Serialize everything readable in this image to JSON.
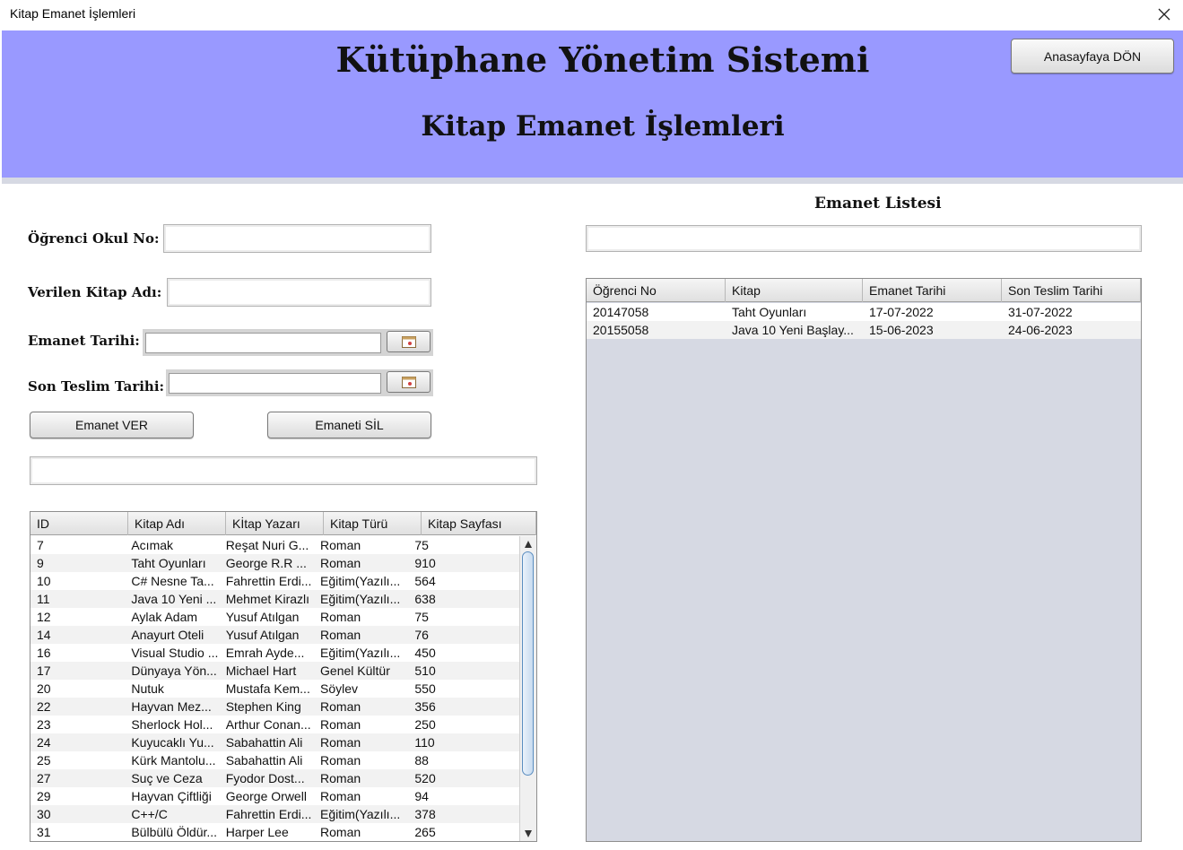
{
  "window": {
    "title": "Kitap Emanet İşlemleri",
    "close_icon": "close-icon"
  },
  "header": {
    "title": "Kütüphane Yönetim Sistemi",
    "subtitle": "Kitap Emanet İşlemleri",
    "home_button": "Anasayfaya DÖN",
    "background": "#9999ff"
  },
  "form": {
    "student_no_label": "Öğrenci Okul No:",
    "student_no_value": "",
    "book_name_label": "Verilen Kitap Adı:",
    "book_name_value": "",
    "loan_date_label": "Emanet Tarihi:",
    "loan_date_value": "",
    "due_date_label": "Son Teslim Tarihi:",
    "due_date_value": "",
    "give_button": "Emanet VER",
    "delete_button": "Emaneti SİL",
    "search_value": ""
  },
  "books_table": {
    "columns": [
      "ID",
      "Kitap Adı",
      "Kİtap Yazarı",
      "Kitap Türü",
      "Kitap Sayfası"
    ],
    "rows": [
      [
        "7",
        "Acımak",
        "Reşat Nuri G...",
        "Roman",
        "75"
      ],
      [
        "9",
        "Taht Oyunları",
        "George R.R ...",
        "Roman",
        "910"
      ],
      [
        "10",
        "C# Nesne Ta...",
        "Fahrettin Erdi...",
        "Eğitim(Yazılı...",
        "564"
      ],
      [
        "11",
        "Java 10 Yeni ...",
        "Mehmet Kirazlı",
        "Eğitim(Yazılı...",
        "638"
      ],
      [
        "12",
        "Aylak Adam",
        "Yusuf Atılgan",
        "Roman",
        "75"
      ],
      [
        "14",
        "Anayurt Oteli",
        "Yusuf Atılgan",
        "Roman",
        "76"
      ],
      [
        "16",
        "Visual Studio ...",
        "Emrah Ayde...",
        "Eğitim(Yazılı...",
        "450"
      ],
      [
        "17",
        "Dünyaya Yön...",
        "Michael Hart",
        "Genel Kültür",
        "510"
      ],
      [
        "20",
        "Nutuk",
        "Mustafa Kem...",
        "Söylev",
        "550"
      ],
      [
        "22",
        "Hayvan Mez...",
        "Stephen King",
        "Roman",
        "356"
      ],
      [
        "23",
        "Sherlock Hol...",
        "Arthur Conan...",
        "Roman",
        "250"
      ],
      [
        "24",
        "Kuyucaklı Yu...",
        "Sabahattin Ali",
        "Roman",
        "110"
      ],
      [
        "25",
        "Kürk Mantolu...",
        "Sabahattin Ali",
        "Roman",
        "88"
      ],
      [
        "27",
        "Suç ve Ceza",
        "Fyodor Dost...",
        "Roman",
        "520"
      ],
      [
        "29",
        "Hayvan Çiftliği",
        "George Orwell",
        "Roman",
        "94"
      ],
      [
        "30",
        "C++/C",
        "Fahrettin Erdi...",
        "Eğitim(Yazılı...",
        "378"
      ],
      [
        "31",
        "Bülbülü Öldür...",
        "Harper Lee",
        "Roman",
        "265"
      ]
    ]
  },
  "loans": {
    "title": "Emanet Listesi",
    "search_value": "",
    "columns": [
      "Öğrenci No",
      "Kitap",
      "Emanet Tarihi",
      "Son Teslim Tarihi"
    ],
    "rows": [
      [
        "20147058",
        "Taht Oyunları",
        "17-07-2022",
        "31-07-2022"
      ],
      [
        "20155058",
        "Java 10 Yeni Başlay...",
        "15-06-2023",
        "24-06-2023"
      ]
    ]
  }
}
